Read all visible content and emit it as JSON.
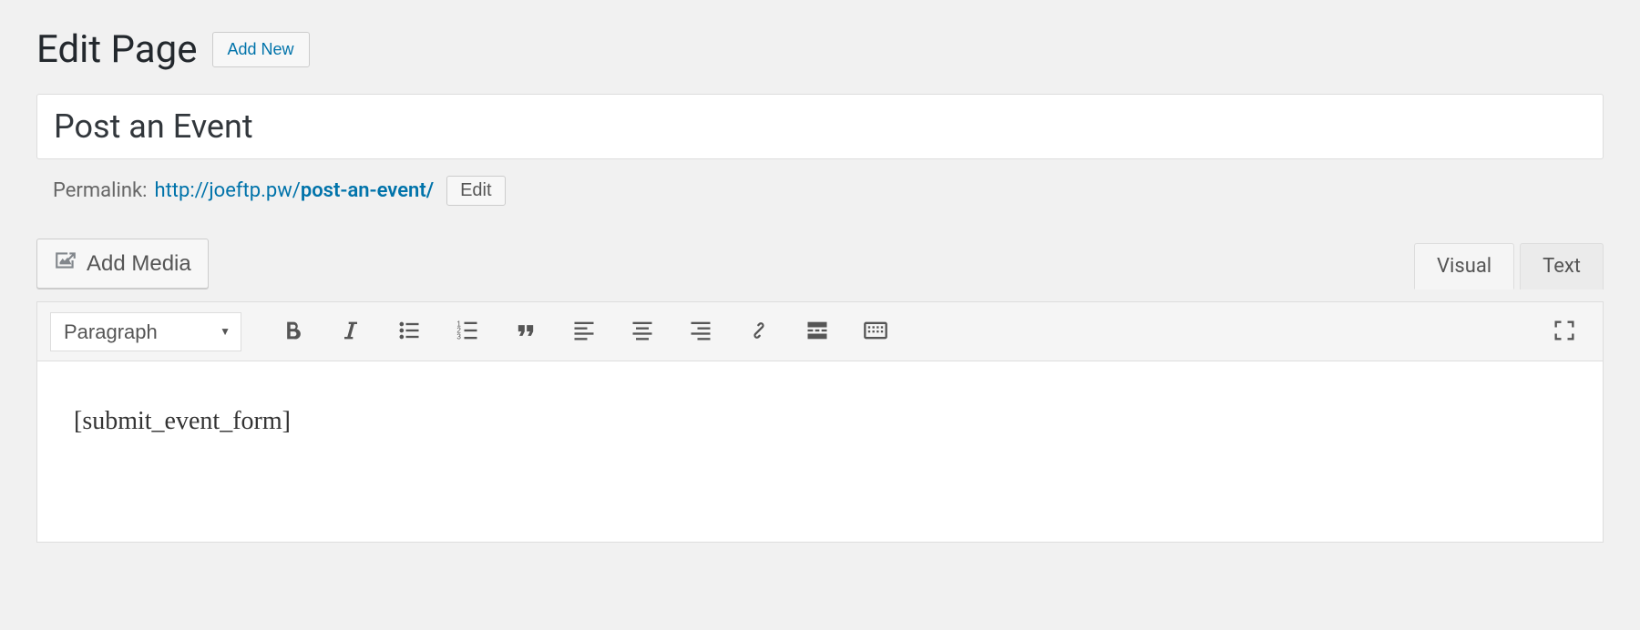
{
  "header": {
    "heading": "Edit Page",
    "add_new_label": "Add New"
  },
  "title": {
    "value": "Post an Event"
  },
  "permalink": {
    "label": "Permalink:",
    "base_url": "http://joeftp.pw/",
    "slug": "post-an-event/",
    "edit_label": "Edit"
  },
  "media": {
    "add_media_label": "Add Media"
  },
  "tabs": {
    "visual": "Visual",
    "text": "Text"
  },
  "toolbar": {
    "format_selected": "Paragraph"
  },
  "editor": {
    "content": "[submit_event_form]"
  }
}
